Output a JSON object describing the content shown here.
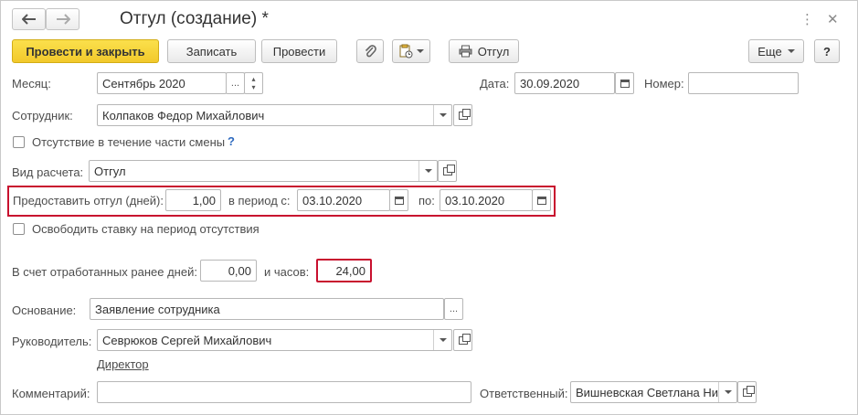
{
  "window": {
    "title": "Отгул (создание) *",
    "more_icon": "⋮",
    "close_icon": "✕"
  },
  "toolbar": {
    "post_close_label": "Провести и закрыть",
    "save_label": "Записать",
    "post_label": "Провести",
    "attach_icon": "paperclip-icon",
    "create_based_icon": "document-add-icon",
    "print_label": "Отгул",
    "more_label": "Еще",
    "help_label": "?"
  },
  "form": {
    "month_label": "Месяц:",
    "month_value": "Сентябрь 2020",
    "date_label": "Дата:",
    "date_value": "30.09.2020",
    "number_label": "Номер:",
    "number_value": "",
    "employee_label": "Сотрудник:",
    "employee_value": "Колпаков Федор Михайлович",
    "partial_shift_label": "Отсутствие в течение части смены",
    "partial_shift_help": "?",
    "calc_type_label": "Вид расчета:",
    "calc_type_value": "Отгул",
    "grant_days_label": "Предоставить отгул (дней):",
    "grant_days_value": "1,00",
    "period_from_label": "в период с:",
    "period_from_value": "03.10.2020",
    "period_to_label": "по:",
    "period_to_value": "03.10.2020",
    "release_rate_label": "Освободить ставку на период отсутствия",
    "worked_days_label": "В счет отработанных ранее дней:",
    "worked_days_value": "0,00",
    "hours_label": "и часов:",
    "hours_value": "24,00",
    "basis_label": "Основание:",
    "basis_value": "Заявление сотрудника",
    "manager_label": "Руководитель:",
    "manager_value": "Севрюков Сергей Михайлович",
    "manager_position": "Директор",
    "comment_label": "Комментарий:",
    "comment_value": "",
    "responsible_label": "Ответственный:",
    "responsible_value": "Вишневская Светлана Ни"
  },
  "colors": {
    "accent_yellow": "#f5d130",
    "highlight_red": "#c8102e",
    "help_blue": "#2f6bbf"
  }
}
